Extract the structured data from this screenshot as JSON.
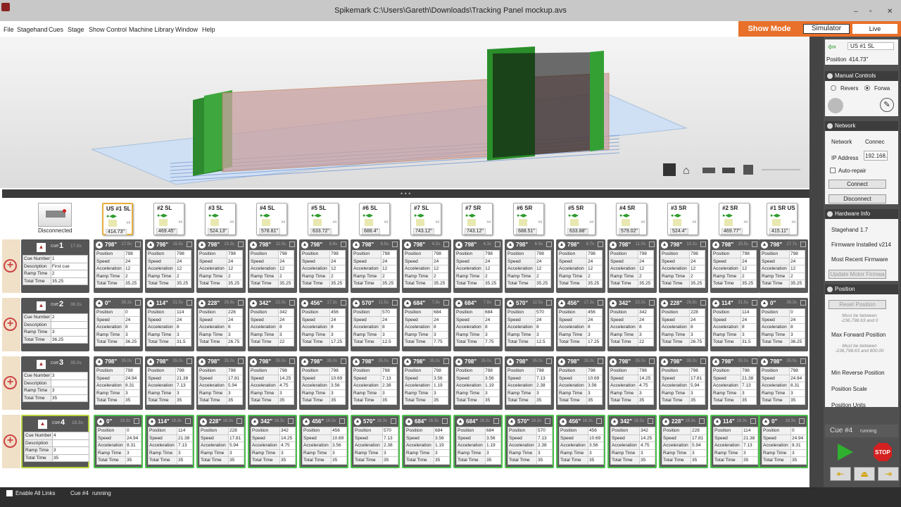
{
  "window": {
    "title": "Spikemark C:\\Users\\Gareth\\Downloads\\Tracking Panel mockup.avs",
    "minimize": "–",
    "maximize": "▫",
    "close": "✕"
  },
  "menu": [
    "File",
    "Stagehand",
    "Cues",
    "Stage",
    "Show Control",
    "Machine Library",
    "Window",
    "Help"
  ],
  "modes": {
    "show_mode": "Show Mode",
    "simulator": "Simulator",
    "live": "Live"
  },
  "toolbar_divider": "• • •",
  "connection": {
    "status": "Disconnected"
  },
  "axes": [
    {
      "name": "US #1 SL",
      "position": "414.73\"",
      "tag": "#4",
      "selected": true
    },
    {
      "name": "#2 SL",
      "position": "469.45\"",
      "tag": "#4"
    },
    {
      "name": "#3 SL",
      "position": "524.13\"",
      "tag": "#4"
    },
    {
      "name": "#4 SL",
      "position": "578.81\"",
      "tag": "#4"
    },
    {
      "name": "#5 SL",
      "position": "633.72\"",
      "tag": "#4"
    },
    {
      "name": "#6 SL",
      "position": "688.4\"",
      "tag": "#4"
    },
    {
      "name": "#7 SL",
      "position": "743.12\"",
      "tag": "#4"
    },
    {
      "name": "#7 SR",
      "position": "743.12\"",
      "tag": "#4"
    },
    {
      "name": "#6 SR",
      "position": "688.51\"",
      "tag": "#4"
    },
    {
      "name": "#5 SR",
      "position": "633.88\"",
      "tag": "#4"
    },
    {
      "name": "#4 SR",
      "position": "579.02\"",
      "tag": "#4"
    },
    {
      "name": "#3 SR",
      "position": "524.4\"",
      "tag": "#4"
    },
    {
      "name": "#2 SR",
      "position": "469.77\"",
      "tag": "#4"
    },
    {
      "name": "#1 SR US",
      "position": "415.11\"",
      "tag": "#4"
    }
  ],
  "field_labels": {
    "cue_number": "Cue Number",
    "description": "Description",
    "ramp_time": "Ramp Time",
    "total_time": "Total Time",
    "position": "Position",
    "speed": "Speed",
    "acceleration": "Acceleration"
  },
  "cues": [
    {
      "word": "cue",
      "num": "1",
      "time": "17.8s",
      "number": "1",
      "description": "First cue",
      "ramp": "2",
      "total": "35.25",
      "active": false,
      "cells": [
        {
          "pos": "798\"",
          "t": "17.8s",
          "p": "798",
          "s": "24",
          "a": "12",
          "r": "2",
          "tt": "35.25"
        },
        {
          "pos": "798\"",
          "t": "15.5s",
          "p": "798",
          "s": "24",
          "a": "12",
          "r": "2",
          "tt": "35.25"
        },
        {
          "pos": "798\"",
          "t": "13.3s",
          "p": "798",
          "s": "24",
          "a": "12",
          "r": "2",
          "tt": "35.25"
        },
        {
          "pos": "798\"",
          "t": "11.0s",
          "p": "798",
          "s": "24",
          "a": "12",
          "r": "2",
          "tt": "35.25"
        },
        {
          "pos": "798\"",
          "t": "8.8s",
          "p": "798",
          "s": "24",
          "a": "12",
          "r": "2",
          "tt": "35.25"
        },
        {
          "pos": "798\"",
          "t": "6.5s",
          "p": "798",
          "s": "24",
          "a": "12",
          "r": "2",
          "tt": "35.25"
        },
        {
          "pos": "798\"",
          "t": "4.3s",
          "p": "798",
          "s": "24",
          "a": "12",
          "r": "2",
          "tt": "35.25"
        },
        {
          "pos": "798\"",
          "t": "4.3s",
          "p": "798",
          "s": "24",
          "a": "12",
          "r": "2",
          "tt": "35.25"
        },
        {
          "pos": "798\"",
          "t": "6.5s",
          "p": "798",
          "s": "24",
          "a": "12",
          "r": "2",
          "tt": "35.25"
        },
        {
          "pos": "798\"",
          "t": "8.7s",
          "p": "798",
          "s": "24",
          "a": "12",
          "r": "2",
          "tt": "35.25"
        },
        {
          "pos": "798\"",
          "t": "11.0s",
          "p": "798",
          "s": "24",
          "a": "12",
          "r": "2",
          "tt": "35.25"
        },
        {
          "pos": "798\"",
          "t": "13.2s",
          "p": "798",
          "s": "24",
          "a": "12",
          "r": "2",
          "tt": "35.25"
        },
        {
          "pos": "798\"",
          "t": "15.5s",
          "p": "798",
          "s": "24",
          "a": "12",
          "r": "2",
          "tt": "35.25"
        },
        {
          "pos": "798\"",
          "t": "17.7s",
          "p": "798",
          "s": "24",
          "a": "12",
          "r": "2",
          "tt": "35.25"
        }
      ]
    },
    {
      "word": "cue",
      "num": "2",
      "time": "36.3s",
      "number": "2",
      "description": "",
      "ramp": "3",
      "total": "36.25",
      "active": false,
      "cells": [
        {
          "pos": "0\"",
          "t": "36.3s",
          "p": "0",
          "s": "24",
          "a": "8",
          "r": "3",
          "tt": "36.25"
        },
        {
          "pos": "114\"",
          "t": "31.5s",
          "p": "114",
          "s": "24",
          "a": "8",
          "r": "3",
          "tt": "31.5"
        },
        {
          "pos": "228\"",
          "t": "26.8s",
          "p": "228",
          "s": "24",
          "a": "8",
          "r": "3",
          "tt": "26.75"
        },
        {
          "pos": "342\"",
          "t": "22.0s",
          "p": "342",
          "s": "24",
          "a": "8",
          "r": "3",
          "tt": "22"
        },
        {
          "pos": "456\"",
          "t": "17.3s",
          "p": "456",
          "s": "24",
          "a": "8",
          "r": "3",
          "tt": "17.25"
        },
        {
          "pos": "570\"",
          "t": "12.5s",
          "p": "570",
          "s": "24",
          "a": "8",
          "r": "3",
          "tt": "12.5"
        },
        {
          "pos": "684\"",
          "t": "7.8s",
          "p": "684",
          "s": "24",
          "a": "8",
          "r": "3",
          "tt": "7.75"
        },
        {
          "pos": "684\"",
          "t": "7.8s",
          "p": "684",
          "s": "24",
          "a": "8",
          "r": "3",
          "tt": "7.75"
        },
        {
          "pos": "570\"",
          "t": "12.5s",
          "p": "570",
          "s": "24",
          "a": "8",
          "r": "3",
          "tt": "12.5"
        },
        {
          "pos": "456\"",
          "t": "17.3s",
          "p": "456",
          "s": "24",
          "a": "8",
          "r": "3",
          "tt": "17.25"
        },
        {
          "pos": "342\"",
          "t": "22.0s",
          "p": "342",
          "s": "24",
          "a": "8",
          "r": "3",
          "tt": "22"
        },
        {
          "pos": "228\"",
          "t": "26.8s",
          "p": "228",
          "s": "24",
          "a": "8",
          "r": "3",
          "tt": "26.75"
        },
        {
          "pos": "114\"",
          "t": "31.5s",
          "p": "114",
          "s": "24",
          "a": "8",
          "r": "3",
          "tt": "31.5"
        },
        {
          "pos": "0\"",
          "t": "36.3s",
          "p": "0",
          "s": "24",
          "a": "8",
          "r": "3",
          "tt": "36.25"
        }
      ]
    },
    {
      "word": "cue",
      "num": "3",
      "time": "35.0s",
      "number": "3",
      "description": "",
      "ramp": "3",
      "total": "35",
      "active": false,
      "cells": [
        {
          "pos": "798\"",
          "t": "35.0s",
          "p": "798",
          "s": "24.94",
          "a": "8.31",
          "r": "3",
          "tt": "35"
        },
        {
          "pos": "798\"",
          "t": "35.0s",
          "p": "798",
          "s": "21.38",
          "a": "7.13",
          "r": "3",
          "tt": "35"
        },
        {
          "pos": "798\"",
          "t": "35.0s",
          "p": "798",
          "s": "17.81",
          "a": "5.94",
          "r": "3",
          "tt": "35"
        },
        {
          "pos": "798\"",
          "t": "35.0s",
          "p": "798",
          "s": "14.25",
          "a": "4.75",
          "r": "3",
          "tt": "35"
        },
        {
          "pos": "798\"",
          "t": "35.0s",
          "p": "798",
          "s": "10.69",
          "a": "3.56",
          "r": "3",
          "tt": "35"
        },
        {
          "pos": "798\"",
          "t": "35.0s",
          "p": "798",
          "s": "7.13",
          "a": "2.38",
          "r": "3",
          "tt": "35"
        },
        {
          "pos": "798\"",
          "t": "35.0s",
          "p": "798",
          "s": "3.56",
          "a": "1.19",
          "r": "3",
          "tt": "35"
        },
        {
          "pos": "798\"",
          "t": "35.0s",
          "p": "798",
          "s": "3.56",
          "a": "1.19",
          "r": "3",
          "tt": "35"
        },
        {
          "pos": "798\"",
          "t": "35.0s",
          "p": "798",
          "s": "7.13",
          "a": "2.38",
          "r": "3",
          "tt": "35"
        },
        {
          "pos": "798\"",
          "t": "35.0s",
          "p": "798",
          "s": "10.69",
          "a": "3.56",
          "r": "3",
          "tt": "35"
        },
        {
          "pos": "798\"",
          "t": "35.0s",
          "p": "798",
          "s": "14.25",
          "a": "4.75",
          "r": "3",
          "tt": "35"
        },
        {
          "pos": "798\"",
          "t": "35.0s",
          "p": "798",
          "s": "17.81",
          "a": "5.94",
          "r": "3",
          "tt": "35"
        },
        {
          "pos": "798\"",
          "t": "35.0s",
          "p": "798",
          "s": "21.38",
          "a": "7.13",
          "r": "3",
          "tt": "35"
        },
        {
          "pos": "798\"",
          "t": "35.0s",
          "p": "798",
          "s": "24.94",
          "a": "8.31",
          "r": "3",
          "tt": "35"
        }
      ]
    },
    {
      "word": "cue",
      "num": "4",
      "time": "18.3s",
      "number": "4",
      "description": "",
      "ramp": "3",
      "total": "35",
      "active": true,
      "cells": [
        {
          "pos": "0\"",
          "t": "18.3s",
          "p": "0",
          "s": "24.94",
          "a": "8.31",
          "r": "3",
          "tt": "35"
        },
        {
          "pos": "114\"",
          "t": "18.3s",
          "p": "114",
          "s": "21.38",
          "a": "7.13",
          "r": "3",
          "tt": "35"
        },
        {
          "pos": "228\"",
          "t": "18.3s",
          "p": "228",
          "s": "17.81",
          "a": "5.94",
          "r": "3",
          "tt": "35"
        },
        {
          "pos": "342\"",
          "t": "18.3s",
          "p": "342",
          "s": "14.25",
          "a": "4.75",
          "r": "3",
          "tt": "35"
        },
        {
          "pos": "456\"",
          "t": "18.3s",
          "p": "456",
          "s": "10.69",
          "a": "3.56",
          "r": "3",
          "tt": "35"
        },
        {
          "pos": "570\"",
          "t": "18.3s",
          "p": "570",
          "s": "7.13",
          "a": "2.38",
          "r": "3",
          "tt": "35"
        },
        {
          "pos": "684\"",
          "t": "18.3s",
          "p": "684",
          "s": "3.56",
          "a": "1.19",
          "r": "3",
          "tt": "35"
        },
        {
          "pos": "684\"",
          "t": "18.3s",
          "p": "684",
          "s": "3.56",
          "a": "1.19",
          "r": "3",
          "tt": "35"
        },
        {
          "pos": "570\"",
          "t": "18.3s",
          "p": "570",
          "s": "7.13",
          "a": "2.38",
          "r": "3",
          "tt": "35"
        },
        {
          "pos": "456\"",
          "t": "18.3s",
          "p": "456",
          "s": "10.69",
          "a": "3.56",
          "r": "3",
          "tt": "35"
        },
        {
          "pos": "342\"",
          "t": "18.3s",
          "p": "342",
          "s": "14.25",
          "a": "4.75",
          "r": "3",
          "tt": "35"
        },
        {
          "pos": "228\"",
          "t": "18.3s",
          "p": "228",
          "s": "17.81",
          "a": "5.94",
          "r": "3",
          "tt": "35"
        },
        {
          "pos": "114\"",
          "t": "18.3s",
          "p": "114",
          "s": "21.38",
          "a": "7.13",
          "r": "3",
          "tt": "35"
        },
        {
          "pos": "0\"",
          "t": "18.3s",
          "p": "0",
          "s": "24.94",
          "a": "8.31",
          "r": "3",
          "tt": "35"
        }
      ]
    }
  ],
  "right_panel": {
    "axis_name": "US #1 SL",
    "position_label": "Position",
    "position_value": "414.73\"",
    "manual_controls": {
      "header": "Manual Controls",
      "reverse": "Revers",
      "forward": "Forwa"
    },
    "network": {
      "header": "Network",
      "network_label": "Network",
      "network_value": "Connec",
      "ip_label": "IP Address",
      "ip_value": "192.168.",
      "auto_repair": "Auto-repair",
      "connect": "Connect",
      "disconnect": "Disconnect"
    },
    "hardware": {
      "header": "Hardware Info",
      "stagehand": "Stagehand 1.7",
      "firmware": "Firmware Installed v214",
      "recent": "Most Recent Firmware",
      "update": "Update Motor Firmwa"
    },
    "position": {
      "header": "Position",
      "reset": "Reset Position",
      "note1": "Must be between -236,798.63 and 0",
      "max_fwd": "Max Forward Position",
      "note2": "Must be between -236,798.63 and 800.00",
      "min_rev": "Min Reverse Position",
      "scale": "Position Scale",
      "units": "Position Units"
    },
    "cue_status": {
      "cue": "Cue #4",
      "state": "running"
    }
  },
  "status_bar": {
    "enable_all_links": "Enable All Links",
    "cue": "Cue #4",
    "state": "running"
  },
  "colors": {
    "accent_orange": "#e8702a",
    "go_green": "#2fb02f",
    "stop_red": "#d42020",
    "active_cue_border": "#b6d23a",
    "cell_running_border": "#4cc04c"
  }
}
